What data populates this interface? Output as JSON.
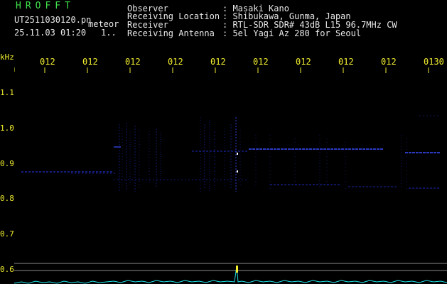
{
  "header": {
    "logo": "HROFFT",
    "filename": "UT2511030120.pn",
    "event_type": "meteor",
    "datetime": "25.11.03 01:20",
    "count": "1..",
    "fields": [
      {
        "label": "Observer",
        "value": ": Masaki Kano"
      },
      {
        "label": "Receiving Location",
        "value": ": Shibukawa, Gunma, Japan"
      },
      {
        "label": "Receiver",
        "value": ": RTL-SDR SDR# 43dB L15 96.7MHz CW"
      },
      {
        "label": "Receiving Antenna",
        "value": ": 5el Yagi Az 280 for Seoul"
      }
    ]
  },
  "axis": {
    "unit": "kHz",
    "y_ticks": [
      "1.1",
      "1.0",
      "0.9",
      "0.8",
      "0.7",
      "0.6"
    ],
    "x_ticks": [
      "012",
      "012",
      "012",
      "012",
      "012",
      "012",
      "012",
      "012",
      "012",
      "0130"
    ]
  },
  "colors": {
    "background": "#000000",
    "title_green": "#3fe34a",
    "axis_yellow": "#f2ee2e",
    "signal_blue": "#2a3cff",
    "trace_cyan": "#1ee0e6"
  }
}
